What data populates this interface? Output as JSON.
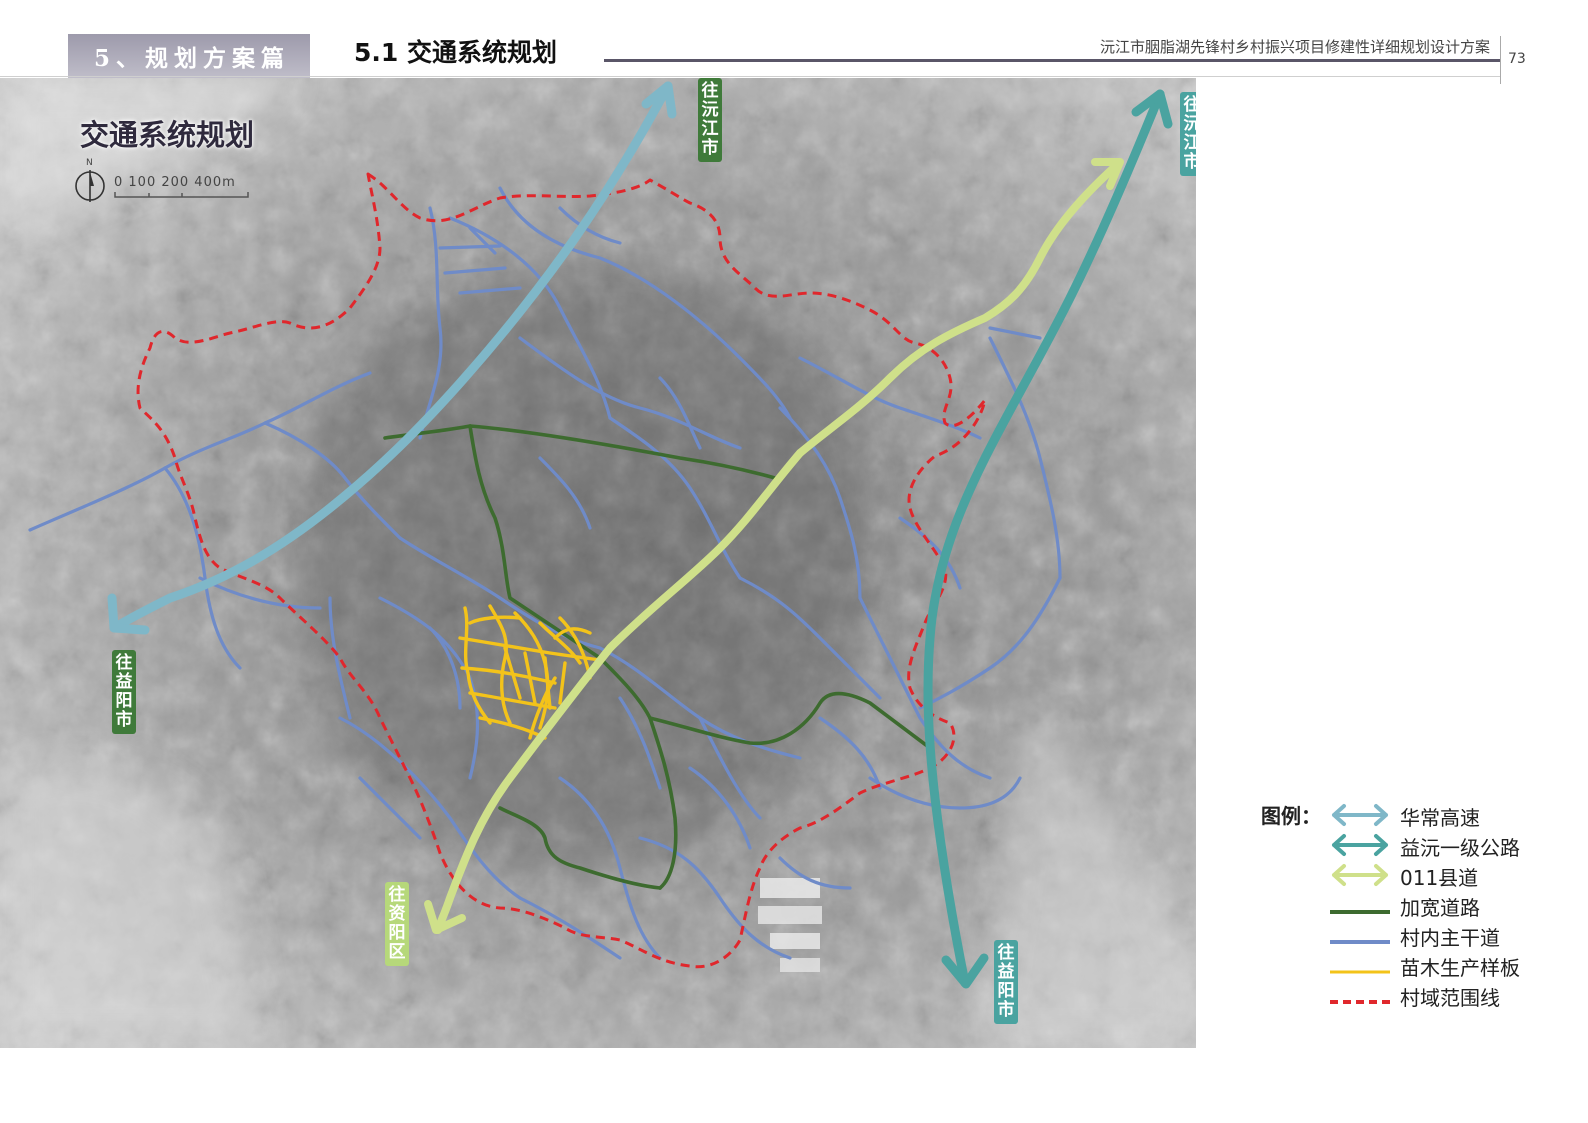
{
  "header": {
    "section_tab": "5、规划方案篇",
    "title": "5.1 交通系统规划",
    "document_title": "沅江市胭脂湖先锋村乡村振兴项目修建性详细规划设计方案",
    "page_number": "73"
  },
  "map": {
    "title": "交通系统规划",
    "north_label": "N",
    "scale_label": "0  100  200     400m",
    "direction_labels": [
      {
        "text": "往沅江市",
        "color": "#3f7a3a"
      },
      {
        "text": "往沅江市",
        "color": "#4aa3a0"
      },
      {
        "text": "往益阳市",
        "color": "#3f7a3a"
      },
      {
        "text": "往资阳区",
        "color": "#b6d87a"
      },
      {
        "text": "往益阳市",
        "color": "#4aa3a0"
      }
    ]
  },
  "legend": {
    "title": "图例：",
    "items": [
      {
        "label": "华常高速",
        "color": "#7fb7c8",
        "symbol": "double-arrow"
      },
      {
        "label": "益沅一级公路",
        "color": "#4aa3a0",
        "symbol": "double-arrow"
      },
      {
        "label": "011县道",
        "color": "#cfe08a",
        "symbol": "double-arrow"
      },
      {
        "label": "加宽道路",
        "color": "#3d6b2f",
        "symbol": "line"
      },
      {
        "label": "村内主干道",
        "color": "#6f8bc8",
        "symbol": "line"
      },
      {
        "label": "苗木生产样板",
        "color": "#f3c31a",
        "symbol": "line"
      },
      {
        "label": "村域范围线",
        "color": "#e0272c",
        "symbol": "dashed-line"
      }
    ]
  }
}
